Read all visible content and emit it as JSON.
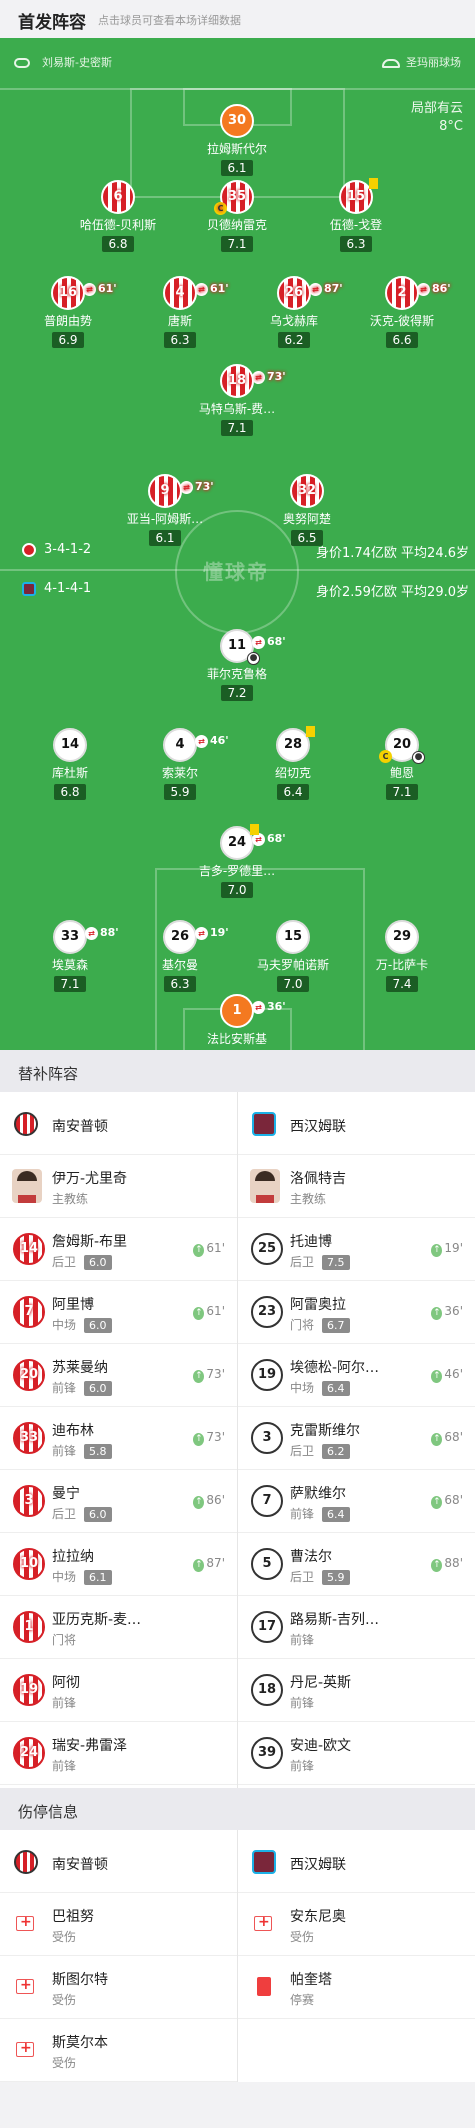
{
  "header": {
    "title": "首发阵容",
    "subtitle": "点击球员可查看本场详细数据"
  },
  "pitch": {
    "home_referee": "刘易斯-史密斯",
    "away_referee": "圣玛丽球场",
    "weather": {
      "line1": "局部有云",
      "line2": "8°C"
    },
    "watermark": "懂球帝",
    "home_formation": "3-4-1-2",
    "home_value": "身价1.74亿欧  平均24.6岁",
    "away_formation": "4-1-4-1",
    "away_value": "身价2.59亿欧  平均29.0岁"
  },
  "home_players": [
    {
      "num": "30",
      "name": "拉姆斯代尔",
      "rating": "6.1",
      "gk": true
    },
    {
      "num": "6",
      "name": "哈伍德-贝利斯",
      "rating": "6.8"
    },
    {
      "num": "35",
      "name": "贝德纳雷克",
      "rating": "7.1",
      "captain": true
    },
    {
      "num": "15",
      "name": "伍德-戈登",
      "rating": "6.3",
      "yellow": true
    },
    {
      "num": "16",
      "name": "普朗由势",
      "rating": "6.9",
      "sub": "61'"
    },
    {
      "num": "4",
      "name": "唐斯",
      "rating": "6.3",
      "sub": "61'"
    },
    {
      "num": "26",
      "name": "乌戈赫库",
      "rating": "6.2",
      "sub": "87'"
    },
    {
      "num": "2",
      "name": "沃克-彼得斯",
      "rating": "6.6",
      "sub": "86'"
    },
    {
      "num": "18",
      "name": "马特乌斯-费…",
      "rating": "7.1",
      "sub": "73'"
    },
    {
      "num": "9",
      "name": "亚当-阿姆斯…",
      "rating": "6.1",
      "sub": "73'"
    },
    {
      "num": "32",
      "name": "奥努阿楚",
      "rating": "6.5"
    }
  ],
  "away_players": [
    {
      "num": "11",
      "name": "菲尔克鲁格",
      "rating": "7.2",
      "sub": "68'",
      "goal": true
    },
    {
      "num": "14",
      "name": "库杜斯",
      "rating": "6.8"
    },
    {
      "num": "4",
      "name": "索莱尔",
      "rating": "5.9",
      "sub": "46'"
    },
    {
      "num": "28",
      "name": "绍切克",
      "rating": "6.4",
      "yellow": true
    },
    {
      "num": "20",
      "name": "鲍恩",
      "rating": "7.1",
      "captain": true,
      "goal": true
    },
    {
      "num": "24",
      "name": "吉多-罗德里…",
      "rating": "7.0",
      "sub": "68'",
      "yellow": true
    },
    {
      "num": "33",
      "name": "埃莫森",
      "rating": "7.1",
      "sub": "88'"
    },
    {
      "num": "26",
      "name": "基尔曼",
      "rating": "6.3",
      "sub": "19'"
    },
    {
      "num": "15",
      "name": "马夫罗帕诺斯",
      "rating": "7.0"
    },
    {
      "num": "29",
      "name": "万-比萨卡",
      "rating": "7.4"
    },
    {
      "num": "1",
      "name": "法比安斯基",
      "rating": "7.7",
      "gk": true,
      "star": true,
      "sub": "36'"
    }
  ],
  "subs_section": {
    "title": "替补阵容",
    "home_team": "南安普顿",
    "away_team": "西汉姆联",
    "home_coach": {
      "name": "伊万-尤里奇",
      "role": "主教练"
    },
    "away_coach": {
      "name": "洛佩特吉",
      "role": "主教练"
    },
    "home_subs": [
      {
        "num": "14",
        "name": "詹姆斯-布里",
        "pos": "后卫",
        "rating": "6.0",
        "time": "61'"
      },
      {
        "num": "7",
        "name": "阿里博",
        "pos": "中场",
        "rating": "6.0",
        "time": "61'"
      },
      {
        "num": "20",
        "name": "苏莱曼纳",
        "pos": "前锋",
        "rating": "6.0",
        "time": "73'"
      },
      {
        "num": "33",
        "name": "迪布林",
        "pos": "前锋",
        "rating": "5.8",
        "time": "73'"
      },
      {
        "num": "3",
        "name": "曼宁",
        "pos": "后卫",
        "rating": "6.0",
        "time": "86'"
      },
      {
        "num": "10",
        "name": "拉拉纳",
        "pos": "中场",
        "rating": "6.1",
        "time": "87'"
      },
      {
        "num": "1",
        "name": "亚历克斯-麦…",
        "pos": "门将",
        "rating": "",
        "time": ""
      },
      {
        "num": "19",
        "name": "阿彻",
        "pos": "前锋",
        "rating": "",
        "time": ""
      },
      {
        "num": "24",
        "name": "瑞安-弗雷泽",
        "pos": "前锋",
        "rating": "",
        "time": ""
      }
    ],
    "away_subs": [
      {
        "num": "25",
        "name": "托迪博",
        "pos": "后卫",
        "rating": "7.5",
        "time": "19'"
      },
      {
        "num": "23",
        "name": "阿雷奥拉",
        "pos": "门将",
        "rating": "6.7",
        "time": "36'"
      },
      {
        "num": "19",
        "name": "埃德松-阿尔…",
        "pos": "中场",
        "rating": "6.4",
        "time": "46'"
      },
      {
        "num": "3",
        "name": "克雷斯维尔",
        "pos": "后卫",
        "rating": "6.2",
        "time": "68'"
      },
      {
        "num": "7",
        "name": "萨默维尔",
        "pos": "前锋",
        "rating": "6.4",
        "time": "68'"
      },
      {
        "num": "5",
        "name": "曹法尔",
        "pos": "后卫",
        "rating": "5.9",
        "time": "88'"
      },
      {
        "num": "17",
        "name": "路易斯-吉列…",
        "pos": "前锋",
        "rating": "",
        "time": ""
      },
      {
        "num": "18",
        "name": "丹尼-英斯",
        "pos": "前锋",
        "rating": "",
        "time": ""
      },
      {
        "num": "39",
        "name": "安迪-欧文",
        "pos": "前锋",
        "rating": "",
        "time": ""
      }
    ]
  },
  "injury_section": {
    "title": "伤停信息",
    "home_team": "南安普顿",
    "away_team": "西汉姆联",
    "home": [
      {
        "name": "巴祖努",
        "status": "受伤",
        "type": "injury"
      },
      {
        "name": "斯图尔特",
        "status": "受伤",
        "type": "injury"
      },
      {
        "name": "斯莫尔本",
        "status": "受伤",
        "type": "injury"
      }
    ],
    "away": [
      {
        "name": "安东尼奥",
        "status": "受伤",
        "type": "injury"
      },
      {
        "name": "帕奎塔",
        "status": "停赛",
        "type": "suspension"
      }
    ]
  },
  "colors": {
    "pitch": "#3cac4d",
    "home": "#d62027",
    "away_gk": "#f47920"
  }
}
